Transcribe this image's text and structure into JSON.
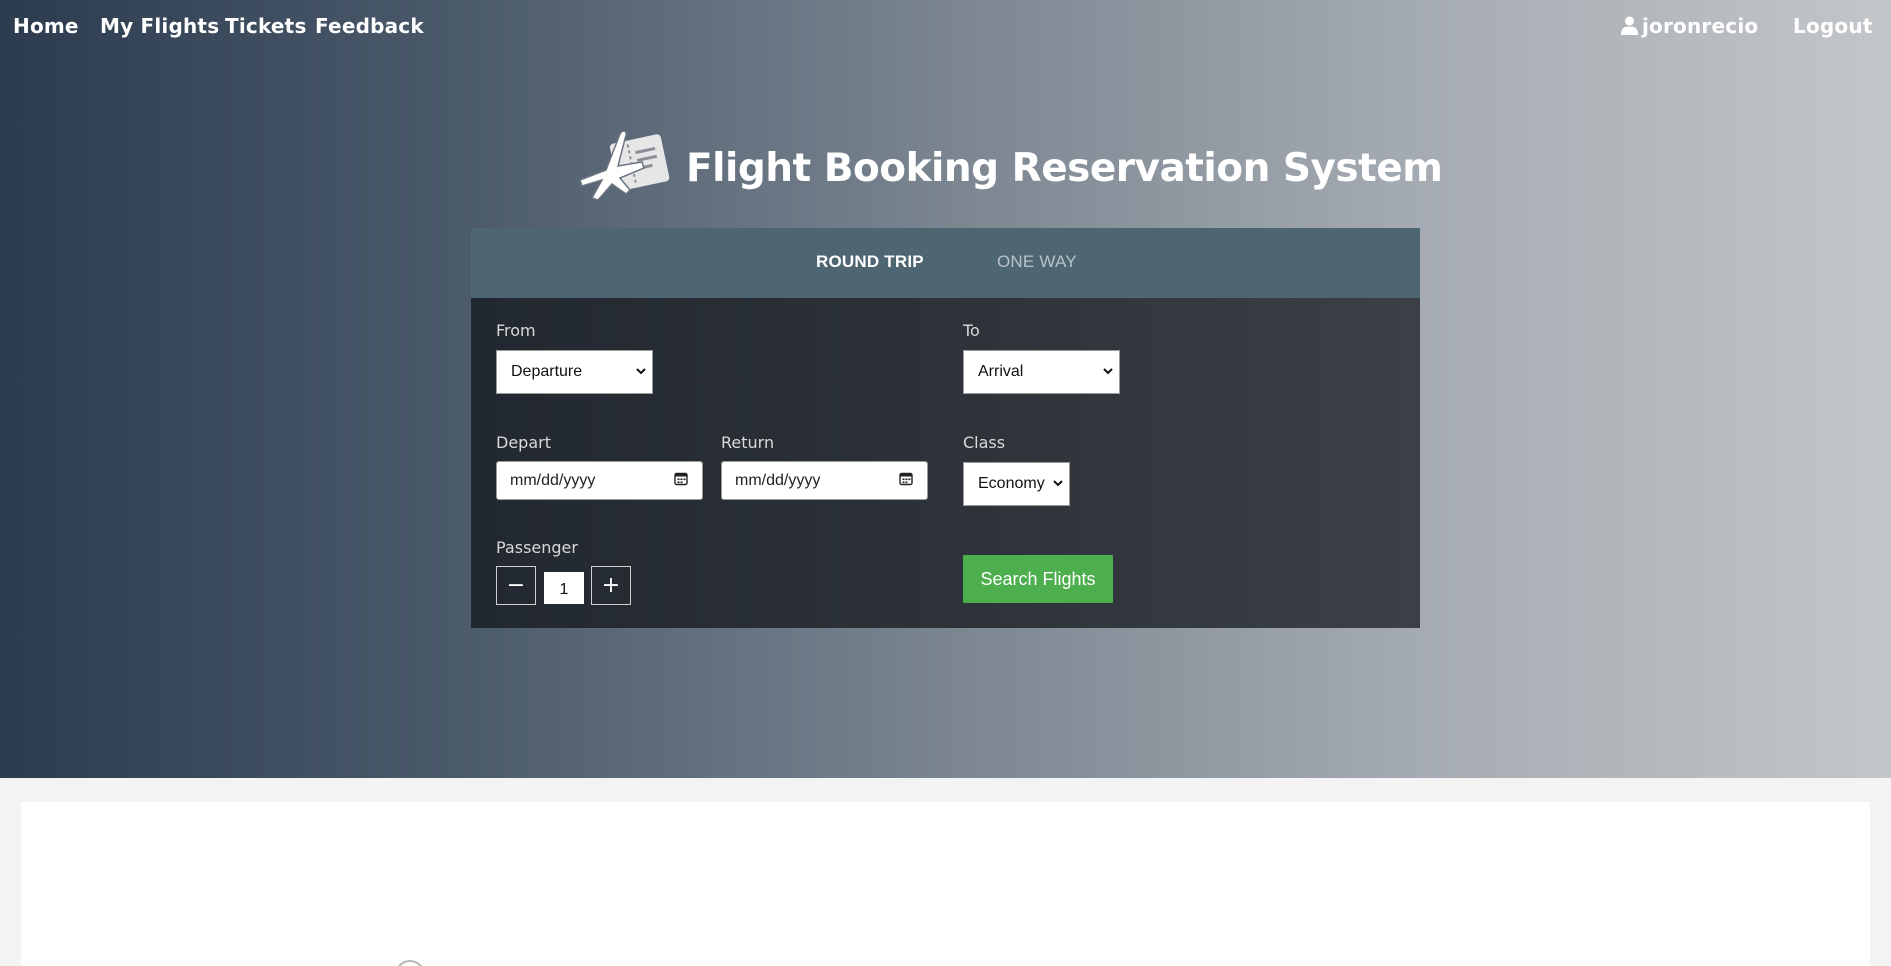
{
  "nav": {
    "home": "Home",
    "my_flights": "My Flights",
    "tickets": "Tickets",
    "feedback": "Feedback",
    "username": "joronrecio",
    "logout": "Logout"
  },
  "brand": {
    "title": "Flight Booking Reservation System",
    "logo_icon": "plane-ticket-icon"
  },
  "search_form": {
    "tabs": [
      {
        "label": "ROUND TRIP",
        "active": true
      },
      {
        "label": "ONE WAY",
        "active": false
      }
    ],
    "from_label": "From",
    "from_value": "Departure",
    "to_label": "To",
    "to_value": "Arrival",
    "depart_label": "Depart",
    "depart_placeholder": "mm/dd/yyyy",
    "return_label": "Return",
    "return_placeholder": "mm/dd/yyyy",
    "class_label": "Class",
    "class_value": "Economy",
    "passenger_label": "Passenger",
    "passenger_value": "1",
    "decrement": "−",
    "increment": "+",
    "search_button": "Search Flights"
  },
  "colors": {
    "tab_bar": "#4d6672",
    "search_button": "#4cae4c",
    "form_bg": "#2d3239"
  }
}
